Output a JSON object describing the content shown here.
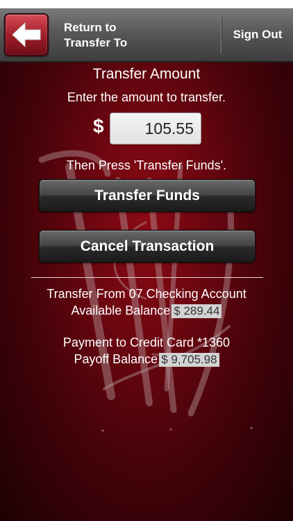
{
  "header": {
    "back_label_line1": "Return to",
    "back_label_line2": "Transfer To",
    "sign_out_label": "Sign Out"
  },
  "transfer": {
    "title": "Transfer Amount",
    "instruction": "Enter the amount to transfer.",
    "currency_symbol": "$",
    "amount_value": "105.55",
    "then_press": "Then Press 'Transfer Funds'.",
    "transfer_button_label": "Transfer Funds",
    "cancel_button_label": "Cancel Transaction"
  },
  "from_account": {
    "label": "Transfer From 07 Checking Account",
    "balance_label": "Available Balance",
    "balance_value": "$ 289.44"
  },
  "to_account": {
    "label": "Payment to Credit Card *1360",
    "balance_label": "Payoff Balance",
    "balance_value": "$ 9,705.98"
  },
  "colors": {
    "header_gray": "#585858",
    "background_red": "#6a0610",
    "back_button_red": "#9b1c27",
    "button_dark": "#2a2a2a"
  },
  "icons": {
    "back": "left-arrow-icon",
    "watermark": "logo-watermark"
  }
}
